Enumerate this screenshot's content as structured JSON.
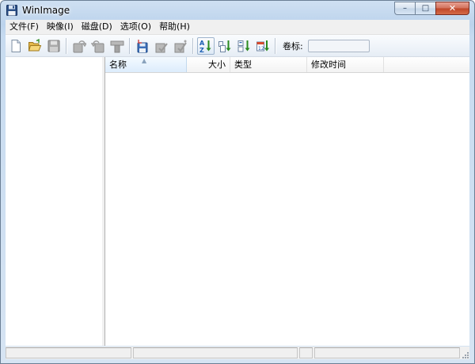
{
  "window": {
    "title": "WinImage",
    "buttons": {
      "minimize": "–",
      "maximize": "□",
      "close": "✕"
    }
  },
  "menu": {
    "items": [
      "文件(F)",
      "映像(I)",
      "磁盘(D)",
      "选项(O)",
      "帮助(H)"
    ]
  },
  "toolbar": {
    "buttons": [
      {
        "name": "new-icon",
        "enabled": true
      },
      {
        "name": "open-folder-icon",
        "enabled": true
      },
      {
        "name": "save-icon",
        "enabled": false
      },
      {
        "name": "read-disk-icon",
        "enabled": false
      },
      {
        "name": "write-disk-icon",
        "enabled": false
      },
      {
        "name": "format-icon",
        "enabled": false
      },
      {
        "name": "inject-icon",
        "enabled": true
      },
      {
        "name": "extract-icon",
        "enabled": false
      },
      {
        "name": "extract-path-icon",
        "enabled": false
      },
      {
        "name": "sort-name-icon",
        "enabled": true,
        "active": true
      },
      {
        "name": "sort-size-icon",
        "enabled": true
      },
      {
        "name": "sort-type-icon",
        "enabled": true
      },
      {
        "name": "sort-date-icon",
        "enabled": true
      }
    ],
    "volume_label": "卷标:",
    "volume_value": ""
  },
  "list": {
    "columns": [
      "名称",
      "大小",
      "类型",
      "修改时间"
    ],
    "sorted_column": "名称",
    "rows": []
  },
  "colors": {
    "title_gradient": "#c7dbf0",
    "close_button": "#c8553a",
    "sort_arrow": "#2a8a1f",
    "sort_letters": "#1c5fb3"
  }
}
